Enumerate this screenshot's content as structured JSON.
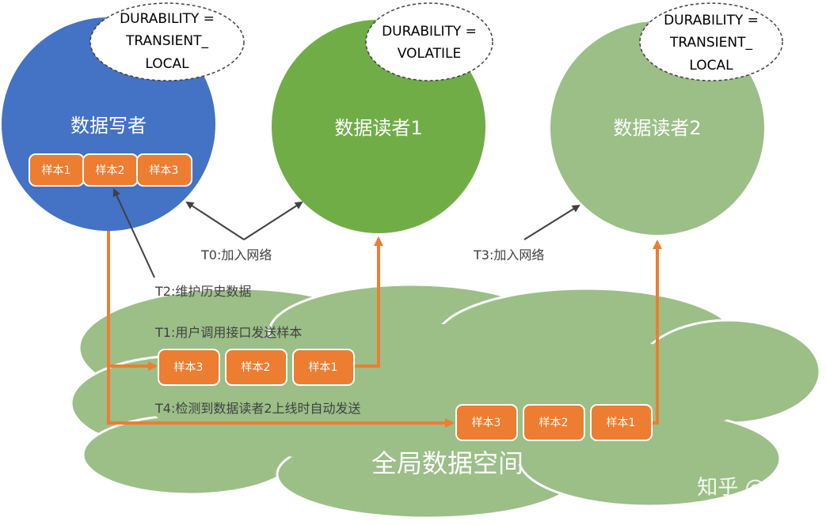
{
  "writer": {
    "label": "数据写者",
    "qos": [
      "DURABILITY =",
      "TRANSIENT_",
      "LOCAL"
    ],
    "samples": [
      "样本1",
      "样本2",
      "样本3"
    ]
  },
  "reader1": {
    "label": "数据读者1",
    "qos": [
      "DURABILITY =",
      "VOLATILE"
    ]
  },
  "reader2": {
    "label": "数据读者2",
    "qos": [
      "DURABILITY =",
      "TRANSIENT_",
      "LOCAL"
    ]
  },
  "annotations": {
    "t0": "T0:加入网络",
    "t1": "T1:用户调用接口发送样本",
    "t2": "T2:维护历史数据",
    "t3": "T3:加入网络",
    "t4": "T4:检测到数据读者2上线时自动发送"
  },
  "space": {
    "label": "全局数据空间",
    "row1": [
      "样本3",
      "样本2",
      "样本1"
    ],
    "row2": [
      "样本3",
      "样本2",
      "样本1"
    ]
  },
  "watermark": "知乎 @hzy",
  "colors": {
    "writer": "#4472c4",
    "reader1": "#70ad47",
    "reader2": "#9bbf87",
    "cloud": "#9bbf87",
    "sample": "#ed7d31",
    "arrow_gray": "#404040"
  }
}
